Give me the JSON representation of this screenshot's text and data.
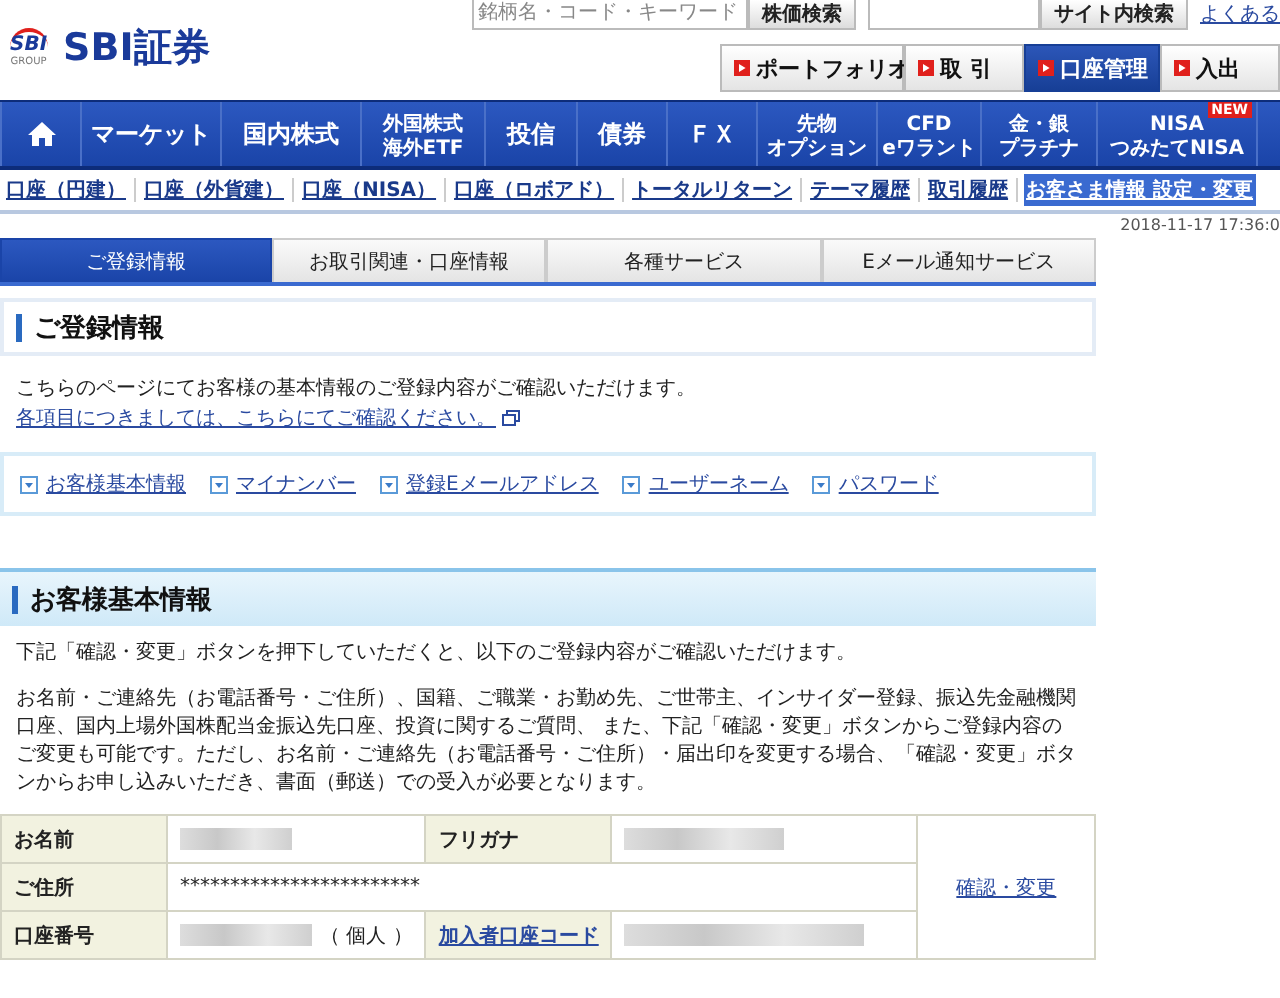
{
  "header": {
    "logo_mark": "SBI",
    "logo_sub": "GROUP",
    "logo_text": "SBI証券",
    "stock_search": {
      "placeholder": "銘柄名・コード・キーワード",
      "button": "株価検索"
    },
    "site_search": {
      "button": "サイト内検索"
    },
    "help_link": "よくある",
    "top_buttons": [
      {
        "label": "ポートフォリオ",
        "selected": false
      },
      {
        "label": "取 引",
        "selected": false
      },
      {
        "label": "口座管理",
        "selected": true
      },
      {
        "label": "入出",
        "selected": false
      }
    ]
  },
  "nav": [
    {
      "kind": "home"
    },
    {
      "kind": "text",
      "lines": [
        "マーケット"
      ]
    },
    {
      "kind": "text",
      "lines": [
        "国内株式"
      ]
    },
    {
      "kind": "text",
      "lines": [
        "外国株式",
        "海外ETF"
      ]
    },
    {
      "kind": "text",
      "lines": [
        "投信"
      ]
    },
    {
      "kind": "text",
      "lines": [
        "債券"
      ]
    },
    {
      "kind": "text",
      "lines": [
        "ＦＸ"
      ]
    },
    {
      "kind": "text",
      "lines": [
        "先物",
        "オプション"
      ]
    },
    {
      "kind": "text",
      "lines": [
        "CFD",
        "eワラント"
      ]
    },
    {
      "kind": "text",
      "lines": [
        "金・銀",
        "プラチナ"
      ]
    },
    {
      "kind": "text",
      "lines": [
        "NISA",
        "つみたてNISA"
      ],
      "badge": "NEW"
    }
  ],
  "subnav": [
    {
      "label": "口座（円建）",
      "selected": false
    },
    {
      "label": "口座（外貨建）",
      "selected": false
    },
    {
      "label": "口座（NISA）",
      "selected": false
    },
    {
      "label": "口座（ロボアド）",
      "selected": false
    },
    {
      "label": "トータルリターン",
      "selected": false
    },
    {
      "label": "テーマ履歴",
      "selected": false
    },
    {
      "label": "取引履歴",
      "selected": false
    },
    {
      "label": "お客さま情報 設定・変更",
      "selected": true
    }
  ],
  "timestamp": "2018-11-17 17:36:0",
  "tabs": [
    {
      "label": "ご登録情報",
      "selected": true
    },
    {
      "label": "お取引関連・口座情報",
      "selected": false
    },
    {
      "label": "各種サービス",
      "selected": false
    },
    {
      "label": "Eメール通知サービス",
      "selected": false
    }
  ],
  "section_heading": "ご登録情報",
  "intro": "こちらのページにてお客様の基本情報のご登録内容がご確認いただけます。",
  "intro_link": "各項目につきましては、こちらにてご確認ください。",
  "anchors": [
    "お客様基本情報",
    "マイナンバー",
    "登録Eメールアドレス",
    "ユーザーネーム",
    "パスワード"
  ],
  "basic": {
    "heading": "お客様基本情報",
    "paragraphs": [
      "下記「確認・変更」ボタンを押下していただくと、以下のご登録内容がご確認いただけます。",
      "お名前・ご連絡先（お電話番号・ご住所）、国籍、ご職業・お勤め先、ご世帯主、インサイダー登録、振込先金融機関口座、国内上場外国株配当金振込先口座、投資に関するご質問、 また、下記「確認・変更」ボタンからご登録内容のご変更も可能です。ただし、お名前・ご連絡先（お電話番号・ご住所）・届出印を変更する場合、「確認・変更」ボタンからお申し込みいただき、書面（郵送）での受入が必要となります。"
    ],
    "table": {
      "name_label": "お名前",
      "kana_label": "フリガナ",
      "address_label": "ご住所",
      "address_value": "************************",
      "account_label": "口座番号",
      "account_type": "（ 個人 ）",
      "code_link": "加入者口座コード",
      "action_link": "確認・変更"
    }
  }
}
